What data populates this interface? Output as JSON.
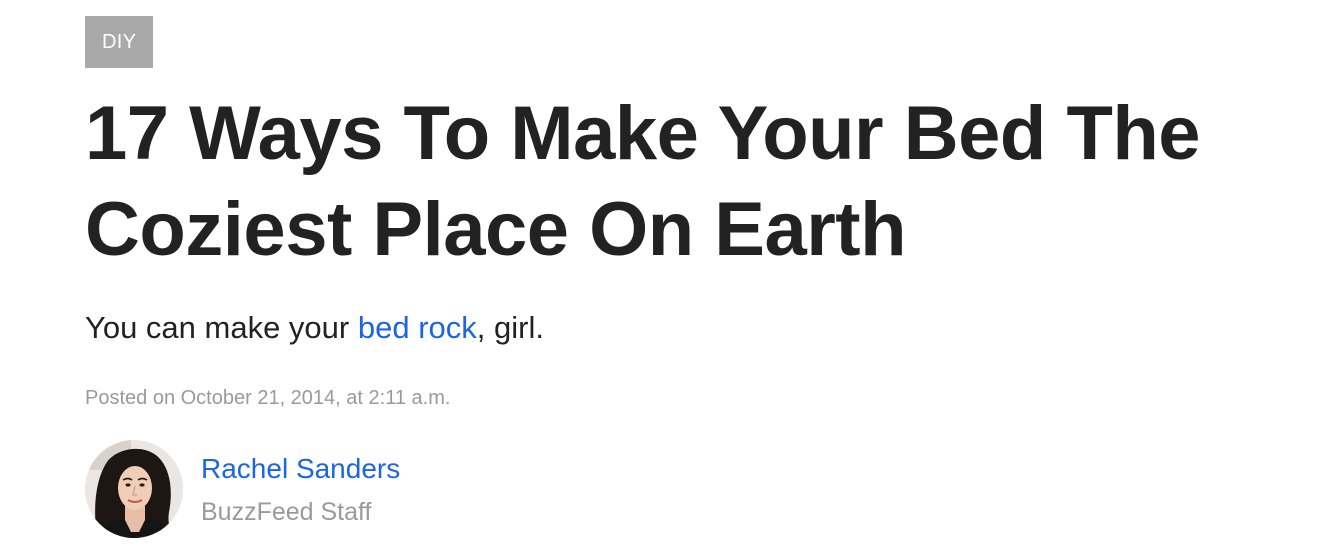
{
  "category": {
    "label": "DIY"
  },
  "article": {
    "title_line1": "17 Ways To Make Your Bed The",
    "title_line2": "Coziest Place On Earth",
    "dek_before": "You can make your ",
    "dek_link": "bed rock",
    "dek_after": ", girl.",
    "posted": "Posted on October 21, 2014, at 2:11 a.m."
  },
  "author": {
    "name": "Rachel Sanders",
    "role": "BuzzFeed Staff",
    "avatar_icon": "author-photo"
  },
  "colors": {
    "link": "#1a66e6",
    "badge_bg": "#a9a9a9",
    "muted": "#9a9a9a",
    "text": "#222222"
  }
}
